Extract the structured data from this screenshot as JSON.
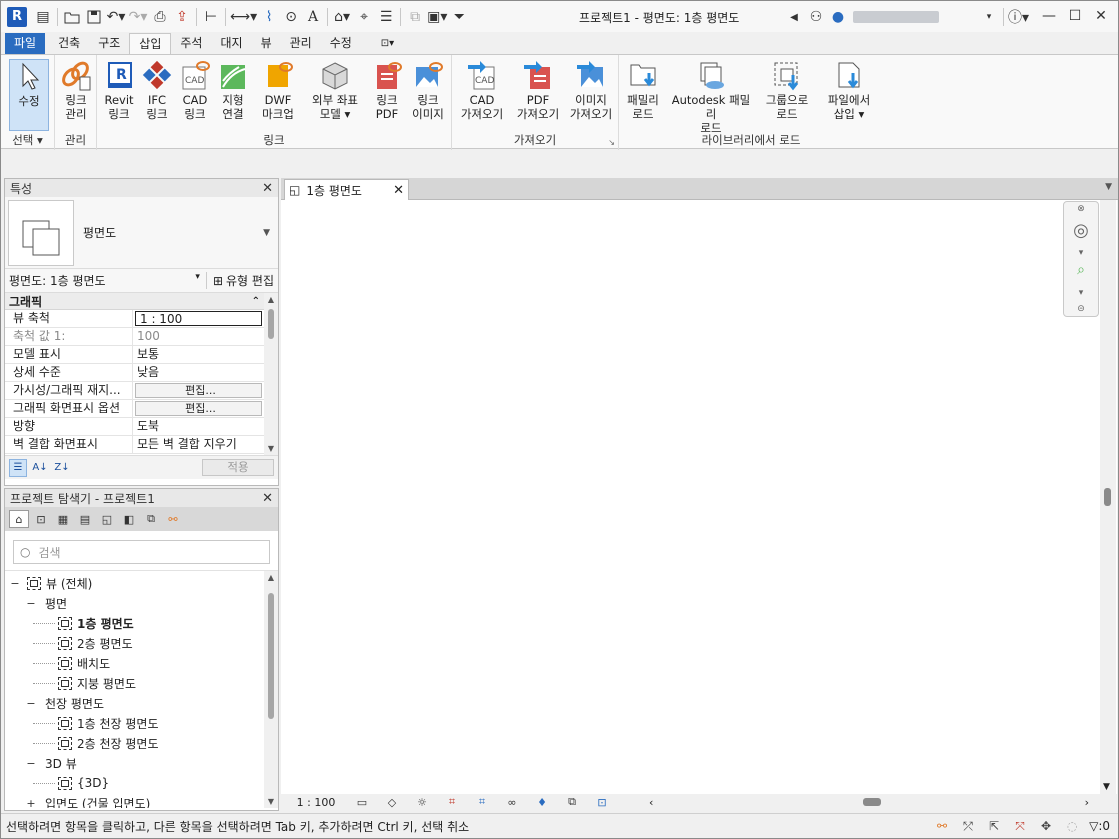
{
  "titlebar": {
    "app_letter": "R",
    "title": "프로젝트1 - 평면도: 1층 평면도"
  },
  "ribbon_tabs": [
    {
      "label": "파일"
    },
    {
      "label": "건축"
    },
    {
      "label": "구조"
    },
    {
      "label": "삽입"
    },
    {
      "label": "주석"
    },
    {
      "label": "대지"
    },
    {
      "label": "뷰"
    },
    {
      "label": "관리"
    },
    {
      "label": "수정"
    }
  ],
  "active_tab": "삽입",
  "ribbon": {
    "select": {
      "button": "수정",
      "group": "선택"
    },
    "manage": {
      "button_line1": "링크",
      "button_line2": "관리",
      "group": "관리"
    },
    "link": {
      "group": "링크",
      "buttons": [
        {
          "l1": "Revit",
          "l2": "링크"
        },
        {
          "l1": "IFC",
          "l2": "링크"
        },
        {
          "l1": "CAD",
          "l2": "링크"
        },
        {
          "l1": "지형",
          "l2": "연결"
        },
        {
          "l1": "DWF",
          "l2": "마크업"
        },
        {
          "l1": "외부 좌표",
          "l2": "모델"
        },
        {
          "l1": "링크",
          "l2": "PDF"
        },
        {
          "l1": "링크",
          "l2": "이미지"
        }
      ]
    },
    "import": {
      "group": "가져오기",
      "buttons": [
        {
          "l1": "CAD",
          "l2": "가져오기"
        },
        {
          "l1": "PDF",
          "l2": "가져오기"
        },
        {
          "l1": "이미지",
          "l2": "가져오기"
        }
      ]
    },
    "library": {
      "group": "라이브러리에서 로드",
      "buttons": [
        {
          "l1": "패밀리",
          "l2": "로드"
        },
        {
          "l1": "Autodesk 패밀리",
          "l2": "로드"
        },
        {
          "l1": "그룹으로",
          "l2": "로드"
        },
        {
          "l1": "파일에서",
          "l2": "삽입"
        }
      ]
    }
  },
  "properties": {
    "title": "특성",
    "type_name": "평면도",
    "instance_selector": "평면도: 1층 평면도",
    "edit_type": "유형 편집",
    "section": "그래픽",
    "rows": [
      {
        "k": "뷰 축척",
        "v": "1 : 100"
      },
      {
        "k": "축척 값    1:",
        "v": "100"
      },
      {
        "k": "모델 표시",
        "v": "보통"
      },
      {
        "k": "상세 수준",
        "v": "낮음"
      },
      {
        "k": "가시성/그래픽 재지...",
        "v": "편집..."
      },
      {
        "k": "그래픽 화면표시 옵션",
        "v": "편집..."
      },
      {
        "k": "방향",
        "v": "도북"
      },
      {
        "k": "벽 결합 화면표시",
        "v": "모든 벽 결합 지우기"
      }
    ],
    "apply": "적용"
  },
  "browser": {
    "title": "프로젝트 탐색기 - 프로젝트1",
    "search_placeholder": "검색",
    "tree": {
      "root": "뷰 (전체)",
      "floor_plans": "평면",
      "fp_items": [
        "1층 평면도",
        "2층 평면도",
        "배치도",
        "지붕 평면도"
      ],
      "ceiling_plans": "천장 평면도",
      "cp_items": [
        "1층 천장 평면도",
        "2층 천장 평면도"
      ],
      "views_3d": "3D 뷰",
      "v3d_items": [
        "{3D}"
      ],
      "elevations": "입면도 (건물 입면도)"
    }
  },
  "view_tab": {
    "label": "1층 평면도"
  },
  "viewbar": {
    "scale": "1 : 100"
  },
  "statusbar": {
    "text": "선택하려면 항목을 클릭하고, 다른 항목을 선택하려면 Tab 키, 추가하려면 Ctrl 키, 선택 취소",
    "filter_count": ":0"
  }
}
